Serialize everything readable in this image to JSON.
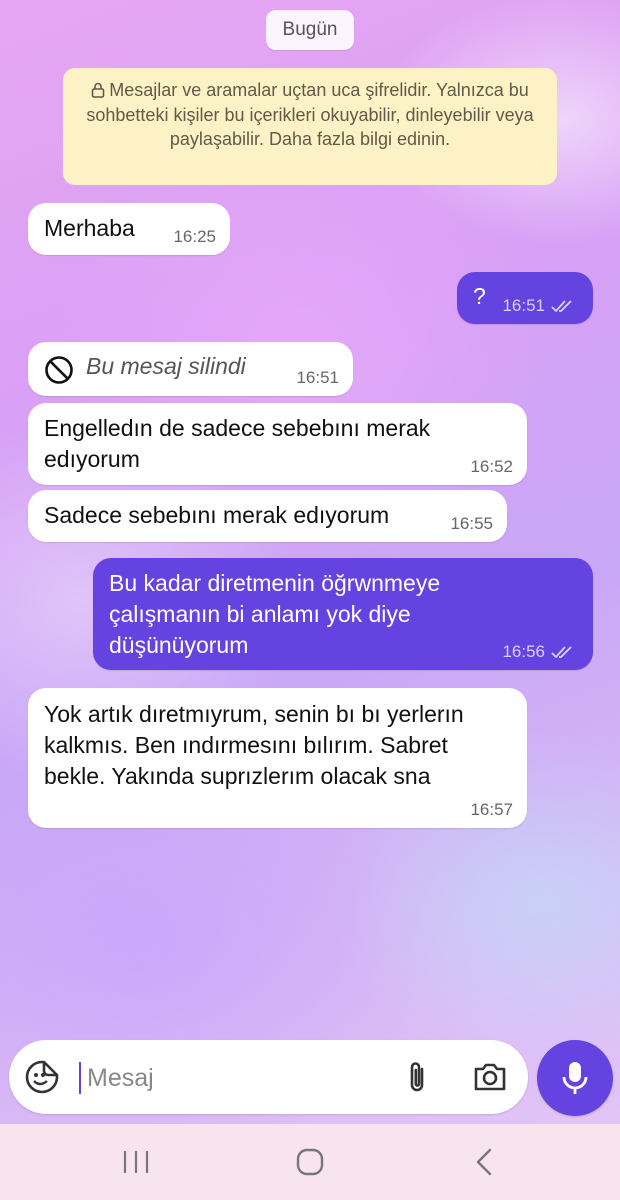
{
  "date_separator": "Bugün",
  "encryption_notice": "Mesajlar ve aramalar uçtan uca şifrelidir. Yalnızca bu sohbetteki kişiler bu içerikleri okuyabilir, dinleyebilir veya paylaşabilir. Daha fazla bilgi edinin.",
  "messages": [
    {
      "direction": "incoming",
      "text": "Merhaba",
      "time": "16:25"
    },
    {
      "direction": "outgoing",
      "text": "?",
      "time": "16:51",
      "read": true
    },
    {
      "direction": "incoming",
      "text": "Bu mesaj silindi",
      "time": "16:51",
      "deleted": true
    },
    {
      "direction": "incoming",
      "text": "Engelledın de sadece sebebını merak edıyorum",
      "time": "16:52"
    },
    {
      "direction": "incoming",
      "text": "Sadece sebebını merak edıyorum",
      "time": "16:55"
    },
    {
      "direction": "outgoing",
      "text": "Bu kadar diretmenin öğrwnmeye çalışmanın bi anlamı yok diye düşünüyorum",
      "time": "16:56",
      "read": true
    },
    {
      "direction": "incoming",
      "text": "Yok artık dıretmıyrum, senin bı bı yerlerın kalkmıs. Ben ındırmesını bılırım. Sabret bekle. Yakında suprızlerım olacak sna",
      "time": "16:57"
    }
  ],
  "composer": {
    "placeholder": "Mesaj",
    "icons": [
      "sticker-icon",
      "attach-icon",
      "camera-icon",
      "mic-icon"
    ]
  },
  "navigation_bar": {
    "icons": [
      "recent-apps-icon",
      "home-icon",
      "back-icon"
    ]
  },
  "colors": {
    "outgoing_bubble": "#6443e0",
    "incoming_bubble": "#ffffff",
    "notice_background": "#fdf2c6"
  }
}
